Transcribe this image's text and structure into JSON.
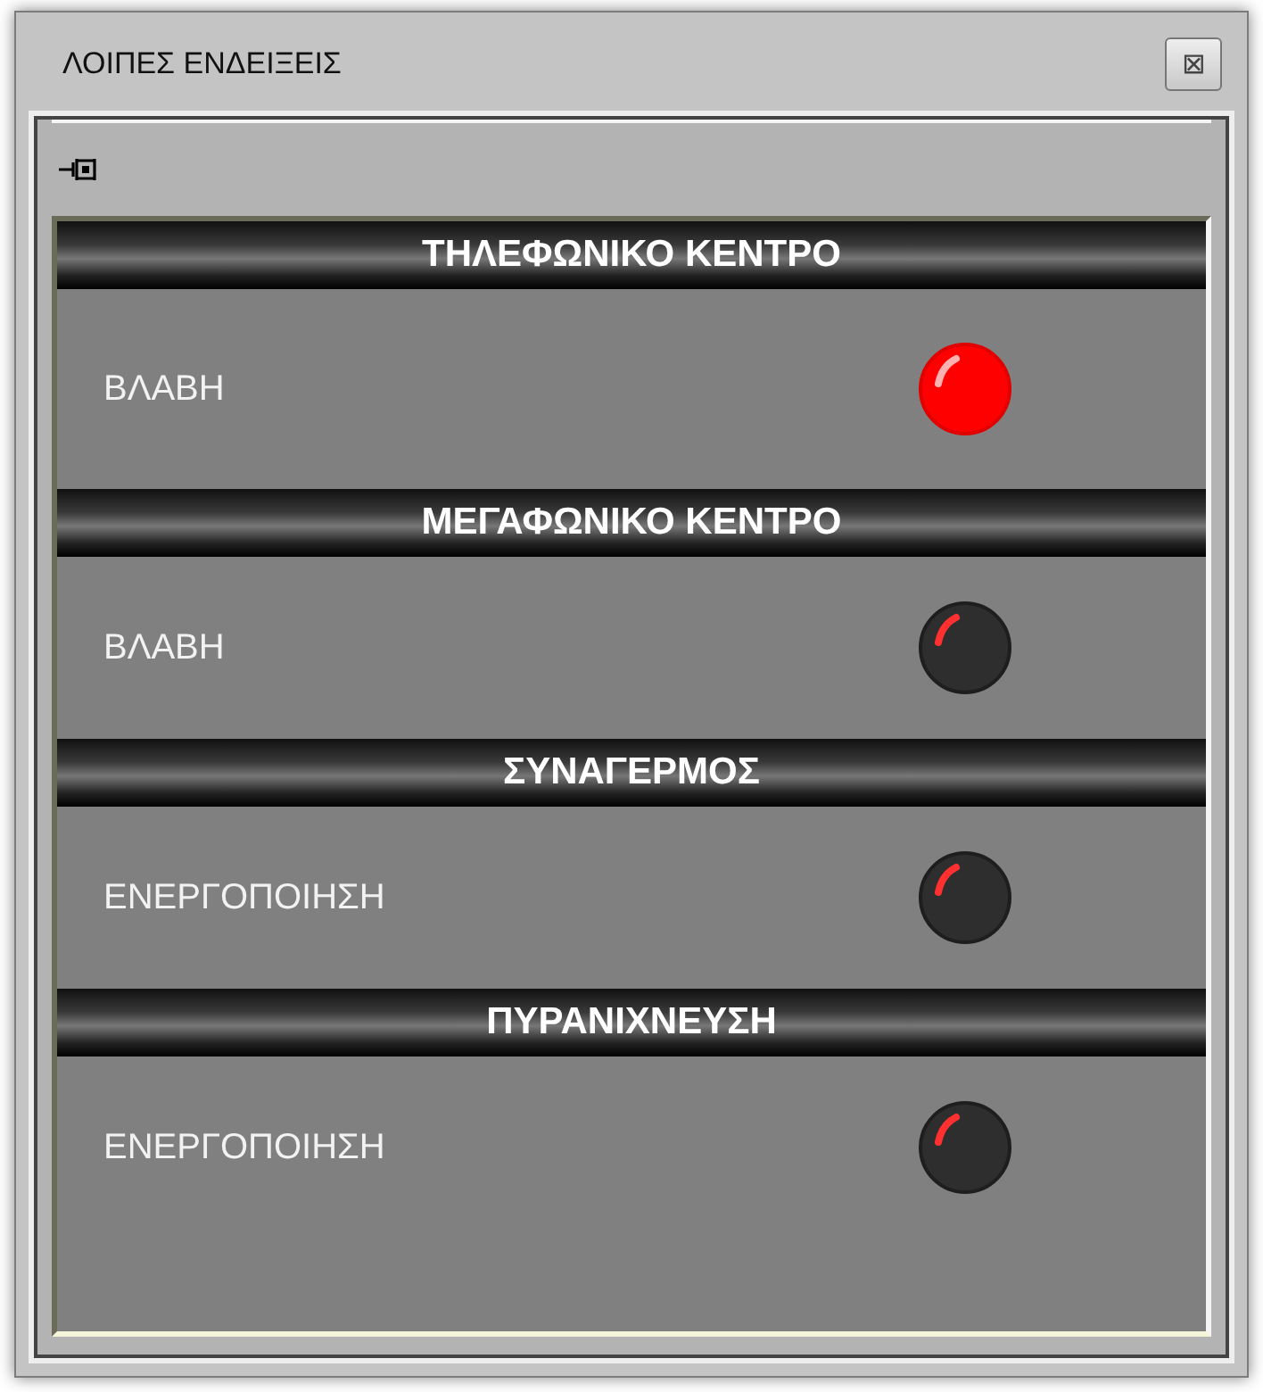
{
  "window": {
    "title": "ΛΟΙΠΕΣ ΕΝΔΕΙΞΕΙΣ",
    "close_glyph": "⊠"
  },
  "sections": [
    {
      "title": "ΤΗΛΕΦΩΝΙΚΟ ΚΕΝΤΡΟ",
      "indicator": {
        "label": "ΒΛΑΒΗ",
        "on": true
      }
    },
    {
      "title": "ΜΕΓΑΦΩΝΙΚΟ ΚΕΝΤΡΟ",
      "indicator": {
        "label": "ΒΛΑΒΗ",
        "on": false
      }
    },
    {
      "title": "ΣΥΝΑΓΕΡΜΟΣ",
      "indicator": {
        "label": "ΕΝΕΡΓΟΠΟΙΗΣΗ",
        "on": false
      }
    },
    {
      "title": "ΠΥΡΑΝΙΧΝΕΥΣΗ",
      "indicator": {
        "label": "ΕΝΕΡΓΟΠΟΙΗΣΗ",
        "on": false
      }
    }
  ]
}
